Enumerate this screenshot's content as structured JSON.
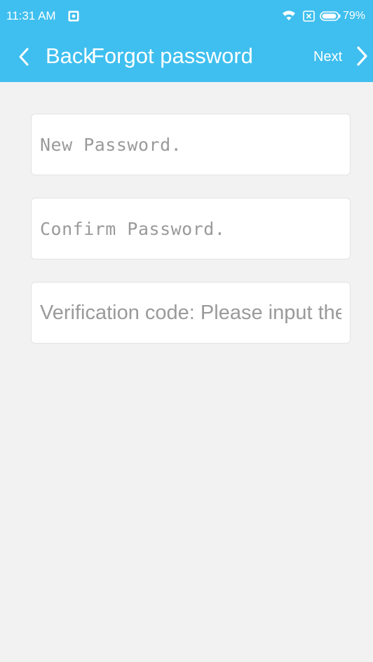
{
  "status_bar": {
    "time": "11:31 AM",
    "battery": "79%"
  },
  "nav": {
    "back_label": "Back",
    "title": "Forgot password",
    "next_label": "Next"
  },
  "form": {
    "new_password": {
      "placeholder": "New Password.",
      "value": ""
    },
    "confirm_password": {
      "placeholder": "Confirm Password.",
      "value": ""
    },
    "verification_code": {
      "placeholder": "Verification code: Please input the",
      "value": ""
    }
  },
  "colors": {
    "accent": "#3fbfef",
    "background": "#f2f2f2",
    "field_background": "#ffffff",
    "placeholder": "#9a9a9a"
  },
  "icons": {
    "notification": "image-notification-icon",
    "wifi": "wifi-icon",
    "sim": "sim-card-icon",
    "battery": "battery-icon",
    "back": "chevron-left-icon",
    "next": "chevron-right-icon"
  }
}
